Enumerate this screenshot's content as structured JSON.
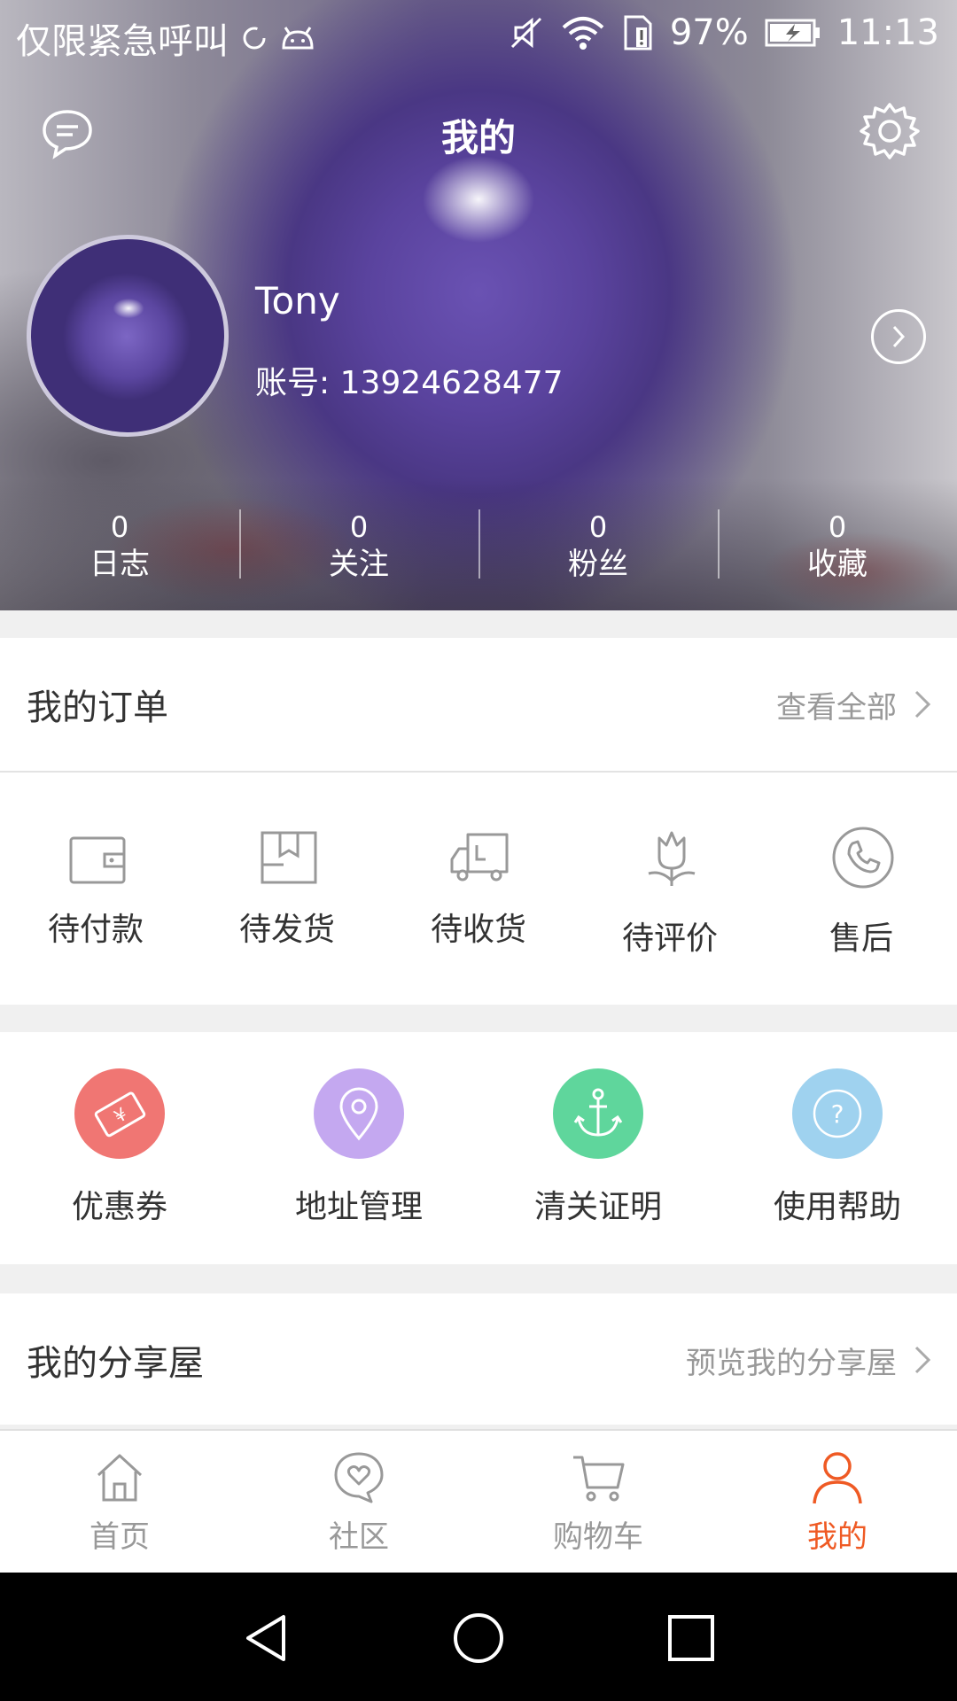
{
  "status_bar": {
    "carrier_text": "仅限紧急呼叫",
    "battery": "97%",
    "time": "11:13",
    "icons": [
      "sync-icon",
      "android-icon",
      "mute-icon",
      "wifi-icon",
      "sim-alert-icon",
      "battery-charging-icon"
    ]
  },
  "header": {
    "title": "我的",
    "message_icon": "chat-bubble-icon",
    "settings_icon": "gear-icon"
  },
  "profile": {
    "name": "Tony",
    "account": "账号: 13924628477"
  },
  "stats": [
    {
      "value": "0",
      "label": "日志"
    },
    {
      "value": "0",
      "label": "关注"
    },
    {
      "value": "0",
      "label": "粉丝"
    },
    {
      "value": "0",
      "label": "收藏"
    }
  ],
  "orders": {
    "title": "我的订单",
    "view_all": "查看全部",
    "items": [
      {
        "label": "待付款",
        "icon": "wallet-icon"
      },
      {
        "label": "待发货",
        "icon": "package-icon"
      },
      {
        "label": "待收货",
        "icon": "truck-icon"
      },
      {
        "label": "待评价",
        "icon": "tulip-icon"
      },
      {
        "label": "售后",
        "icon": "phone-icon"
      }
    ]
  },
  "services": [
    {
      "label": "优惠券",
      "icon": "coupon-icon",
      "color": "#f07673"
    },
    {
      "label": "地址管理",
      "icon": "location-pin-icon",
      "color": "#c4a8f0"
    },
    {
      "label": "清关证明",
      "icon": "anchor-icon",
      "color": "#5fd69c"
    },
    {
      "label": "使用帮助",
      "icon": "help-icon",
      "color": "#9fd2ef"
    }
  ],
  "share": {
    "title": "我的分享屋",
    "preview": "预览我的分享屋"
  },
  "tabs": [
    {
      "label": "首页",
      "icon": "home-icon",
      "active": false
    },
    {
      "label": "社区",
      "icon": "community-heart-icon",
      "active": false
    },
    {
      "label": "购物车",
      "icon": "cart-icon",
      "active": false
    },
    {
      "label": "我的",
      "icon": "person-icon",
      "active": true
    }
  ],
  "colors": {
    "accent": "#ef5a24",
    "muted": "#999999"
  }
}
